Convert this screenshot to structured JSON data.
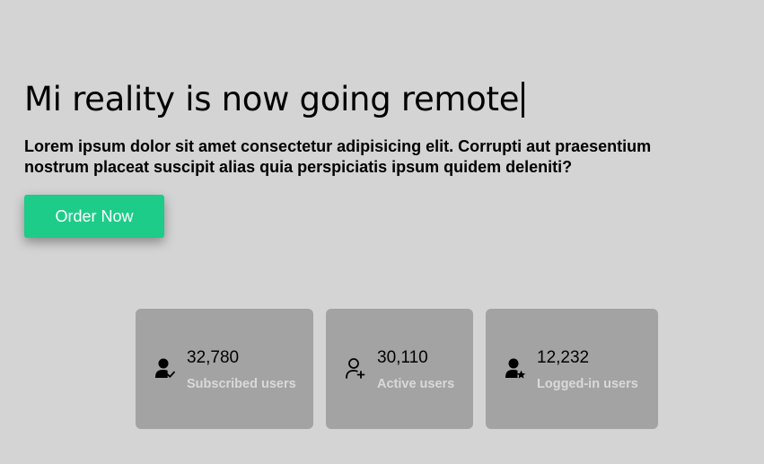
{
  "hero": {
    "title": "Mi reality is now going remote",
    "description": "Lorem ipsum dolor sit amet consectetur adipisicing elit. Corrupti aut praesentium nostrum placeat suscipit alias quia perspiciatis ipsum quidem deleniti?",
    "cta_label": "Order Now"
  },
  "stats": [
    {
      "value": "32,780",
      "label": "Subscribed users",
      "icon": "user-check-icon"
    },
    {
      "value": "30,110",
      "label": "Active users",
      "icon": "user-plus-icon"
    },
    {
      "value": "12,232",
      "label": "Logged-in users",
      "icon": "user-star-icon"
    }
  ],
  "colors": {
    "background": "#d4d4d4",
    "cta": "#1dcc89",
    "card": "#a3a3a3",
    "card_label": "#d9d9d9"
  }
}
